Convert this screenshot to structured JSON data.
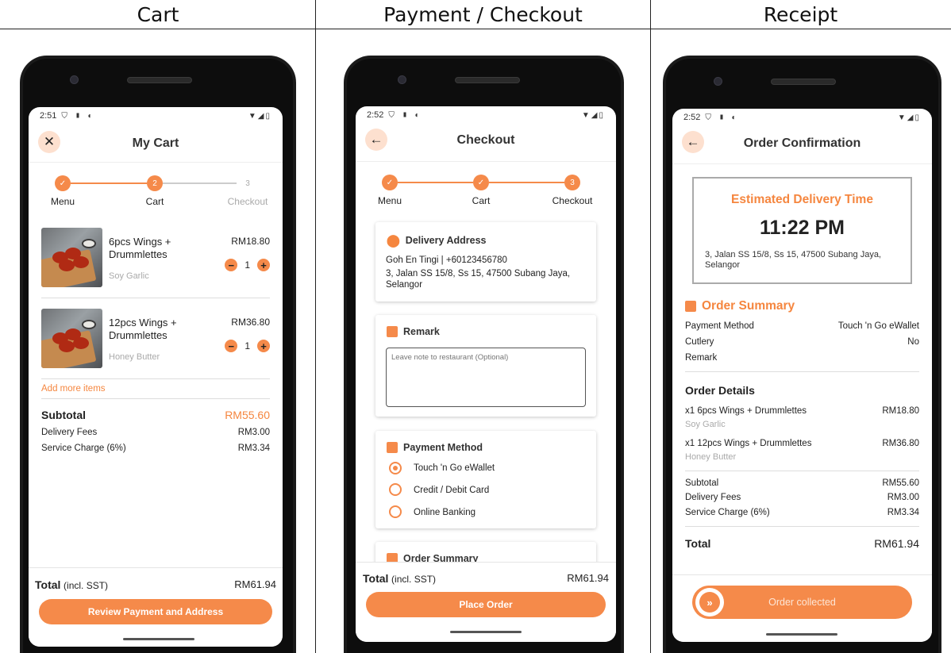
{
  "headers": [
    "Cart",
    "Payment / Checkout",
    "Receipt"
  ],
  "colors": {
    "accent": "#f58a4a",
    "accent_light": "#fde0cf",
    "muted": "#aaaaaa"
  },
  "cart": {
    "time": "2:51",
    "title": "My Cart",
    "close_icon": "close-icon",
    "steps": [
      {
        "label": "Menu",
        "state": "done"
      },
      {
        "label": "Cart",
        "state": "current",
        "num": "2"
      },
      {
        "label": "Checkout",
        "state": "pending",
        "num": "3"
      }
    ],
    "items": [
      {
        "name": "6pcs Wings + Drummlettes",
        "variant": "Soy Garlic",
        "price": "RM18.80",
        "qty": "1"
      },
      {
        "name": "12pcs Wings + Drummlettes",
        "variant": "Honey Butter",
        "price": "RM36.80",
        "qty": "1"
      }
    ],
    "add_more": "Add more items",
    "subtotal_label": "Subtotal",
    "subtotal": "RM55.60",
    "delivery_label": "Delivery Fees",
    "delivery": "RM3.00",
    "service_label": "Service Charge (6%)",
    "service": "RM3.34",
    "total_label": "Total",
    "total_note": "(incl. SST)",
    "total": "RM61.94",
    "button": "Review Payment and Address"
  },
  "checkout": {
    "time": "2:52",
    "title": "Checkout",
    "steps": [
      {
        "label": "Menu",
        "state": "done"
      },
      {
        "label": "Cart",
        "state": "done"
      },
      {
        "label": "Checkout",
        "state": "current",
        "num": "3"
      }
    ],
    "address_title": "Delivery Address",
    "address_name": "Goh En Tingi | +60123456780",
    "address_line": "3, Jalan SS 15/8, Ss 15, 47500 Subang Jaya, Selangor",
    "remark_title": "Remark",
    "remark_placeholder": "Leave note to restaurant (Optional)",
    "payment_title": "Payment Method",
    "payment_options": [
      {
        "label": "Touch 'n Go eWallet",
        "selected": true
      },
      {
        "label": "Credit / Debit Card",
        "selected": false
      },
      {
        "label": "Online Banking",
        "selected": false
      }
    ],
    "summary_title": "Order Summary",
    "total_label": "Total",
    "total_note": "(incl. SST)",
    "total": "RM61.94",
    "button": "Place Order"
  },
  "receipt": {
    "time": "2:52",
    "title": "Order Confirmation",
    "eta_label": "Estimated Delivery Time",
    "eta_time": "11:22 PM",
    "eta_address": "3, Jalan SS 15/8, Ss 15, 47500 Subang Jaya, Selangor",
    "summary_title": "Order Summary",
    "payment_label": "Payment Method",
    "payment_value": "Touch 'n Go eWallet",
    "cutlery_label": "Cutlery",
    "cutlery_value": "No",
    "remark_label": "Remark",
    "details_title": "Order Details",
    "items": [
      {
        "name": "x1 6pcs Wings + Drummlettes",
        "variant": "Soy Garlic",
        "price": "RM18.80"
      },
      {
        "name": "x1 12pcs Wings + Drummlettes",
        "variant": "Honey Butter",
        "price": "RM36.80"
      }
    ],
    "subtotal_label": "Subtotal",
    "subtotal": "RM55.60",
    "delivery_label": "Delivery Fees",
    "delivery": "RM3.00",
    "service_label": "Service Charge (6%)",
    "service": "RM3.34",
    "total_label": "Total",
    "total": "RM61.94",
    "button": "Order collected"
  }
}
